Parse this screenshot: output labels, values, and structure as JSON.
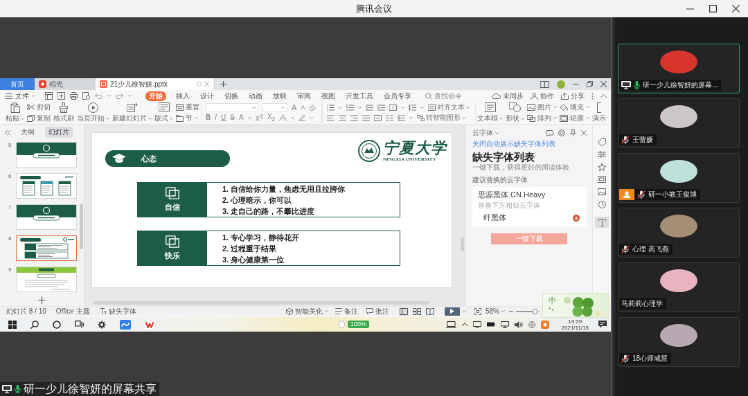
{
  "window": {
    "title": "腾讯会议"
  },
  "wps": {
    "tabs": [
      {
        "label": "首页",
        "kind": "home",
        "selected": false
      },
      {
        "label": "稻壳",
        "kind": "docer",
        "selected": false
      },
      {
        "label": "21少儿徐智妍.pptx",
        "kind": "document",
        "selected": true
      }
    ],
    "menu": {
      "file": "文件",
      "tabs": [
        {
          "label": "开始",
          "selected": true
        },
        {
          "label": "插入",
          "selected": false
        },
        {
          "label": "设计",
          "selected": false
        },
        {
          "label": "切换",
          "selected": false
        },
        {
          "label": "动画",
          "selected": false
        },
        {
          "label": "放映",
          "selected": false
        },
        {
          "label": "审阅",
          "selected": false
        },
        {
          "label": "视图",
          "selected": false
        },
        {
          "label": "开发工具",
          "selected": false
        },
        {
          "label": "会员专享",
          "selected": false
        }
      ],
      "search": {
        "placeholder": "查找命令"
      },
      "actions": [
        "未同步",
        "协作",
        "分享"
      ]
    },
    "ribbon": [
      {
        "kind": "large",
        "label": "粘贴",
        "dropdown": true
      },
      {
        "kind": "stack",
        "items": [
          {
            "label": "剪切",
            "dropdown": false
          },
          {
            "label": "复制",
            "dropdown": false
          }
        ]
      },
      {
        "kind": "large",
        "label": "格式刷",
        "dropdown": false
      },
      {
        "kind": "large",
        "label": "当页开始",
        "dropdown": true
      },
      {
        "kind": "large",
        "label": "新建幻灯片",
        "dropdown": true
      },
      {
        "kind": "large",
        "label": "版式",
        "dropdown": true
      },
      {
        "kind": "stack",
        "items": [
          {
            "label": "重置",
            "dropdown": false
          },
          {
            "label": "节",
            "dropdown": true
          }
        ]
      },
      {
        "kind": "font",
        "sizes": [
          "A",
          "A"
        ],
        "styles": [
          "B",
          "I",
          "U",
          "S",
          "A",
          "X$^{2}$",
          "X$_{2}$"
        ]
      },
      {
        "kind": "paragraph",
        "labels": [
          "对齐文本",
          "转智能图形"
        ]
      },
      {
        "kind": "large",
        "label": "文本框",
        "dropdown": true
      },
      {
        "kind": "large",
        "label": "形状",
        "dropdown": true
      },
      {
        "kind": "stack",
        "items": [
          {
            "label": "图片",
            "dropdown": true
          },
          {
            "label": "排列",
            "dropdown": true
          }
        ]
      },
      {
        "kind": "stack",
        "items": [
          {
            "label": "填充",
            "dropdown": true
          },
          {
            "label": "轮廓",
            "dropdown": true
          }
        ]
      },
      {
        "kind": "large",
        "label": "演示",
        "dropdown": false
      }
    ],
    "panel_tabs": [
      {
        "label": "大纲",
        "selected": false
      },
      {
        "label": "幻灯片",
        "selected": true
      }
    ],
    "thumbnails": [
      {
        "number": "5",
        "kind": "title",
        "selected": false
      },
      {
        "number": "6",
        "kind": "columns",
        "selected": false
      },
      {
        "number": "7",
        "kind": "title",
        "selected": false
      },
      {
        "number": "8",
        "kind": "blocks",
        "selected": true
      },
      {
        "number": "9",
        "kind": "text",
        "selected": false
      }
    ],
    "slide": {
      "title": "心态",
      "logo_name": "宁夏大学",
      "logo_subtitle": "NINGXIA UNIVERSITY",
      "blocks": [
        {
          "label": "自信",
          "lines": [
            "1. 自信给你力量，焦虑无用且拉胯你",
            "2. 心理暗示，你可以",
            "3. 走自己的路，不攀比进度"
          ]
        },
        {
          "label": "快乐",
          "lines": [
            "1. 专心学习，静待花开",
            "2. 过程重于结果",
            "3. 身心健康第一位"
          ]
        }
      ]
    },
    "font_pane": {
      "title": "云字体",
      "link": "关闭自动展示缺失字体列表",
      "heading": "缺失字体列表",
      "subheading": "一键下载，获得更好的阅读体验",
      "section": "建议替换的云字体",
      "missing_font": "思源黑体 CN Heavy",
      "hint": "替换下方相似云字体",
      "replacement": "纤黑体",
      "button": "一键下载"
    },
    "side_tools": [
      {
        "selected": false
      },
      {
        "selected": false
      },
      {
        "selected": false
      },
      {
        "selected": false
      },
      {
        "selected": false
      },
      {
        "selected": false
      },
      {
        "selected": true
      }
    ],
    "status_bar": {
      "slide": "幻灯片 8 / 10",
      "theme": "Office 主题",
      "missing_fonts": "缺失字体",
      "beautify": "智能美化",
      "notes": "备注",
      "comments": "批注",
      "views": [
        {
          "selected": true
        },
        {
          "selected": false
        },
        {
          "selected": false
        }
      ],
      "zoom": "58%",
      "zoom_slider": {
        "level": 0.9
      }
    }
  },
  "ime": {
    "mode": "中"
  },
  "taskbar": {
    "battery": "100%",
    "time": "19:29",
    "date": "2021/11/15"
  },
  "participants": [
    {
      "name": "研一少儿徐智妍的屏幕...",
      "active": true,
      "sharing": true,
      "badge": false,
      "mic": true,
      "muted": false,
      "color": "#d8352c"
    },
    {
      "name": "王蕾媛",
      "active": false,
      "sharing": false,
      "badge": false,
      "mic": true,
      "muted": true,
      "color": "#cdc6c8"
    },
    {
      "name": "研一小教王俊博",
      "active": false,
      "sharing": false,
      "badge": true,
      "mic": true,
      "muted": true,
      "color": "#bfe0da"
    },
    {
      "name": "心理 高飞燕",
      "active": false,
      "sharing": false,
      "badge": false,
      "mic": true,
      "muted": true,
      "color": "#a58d76"
    },
    {
      "name": "马莉莉心理学",
      "active": false,
      "sharing": false,
      "badge": false,
      "mic": false,
      "color": "#e8b4bf"
    },
    {
      "name": "18心师咸慧",
      "active": false,
      "sharing": false,
      "badge": false,
      "mic": true,
      "muted": true,
      "color": "#b9a7b2"
    }
  ],
  "share_label": "研一少儿徐智妍的屏幕共享"
}
